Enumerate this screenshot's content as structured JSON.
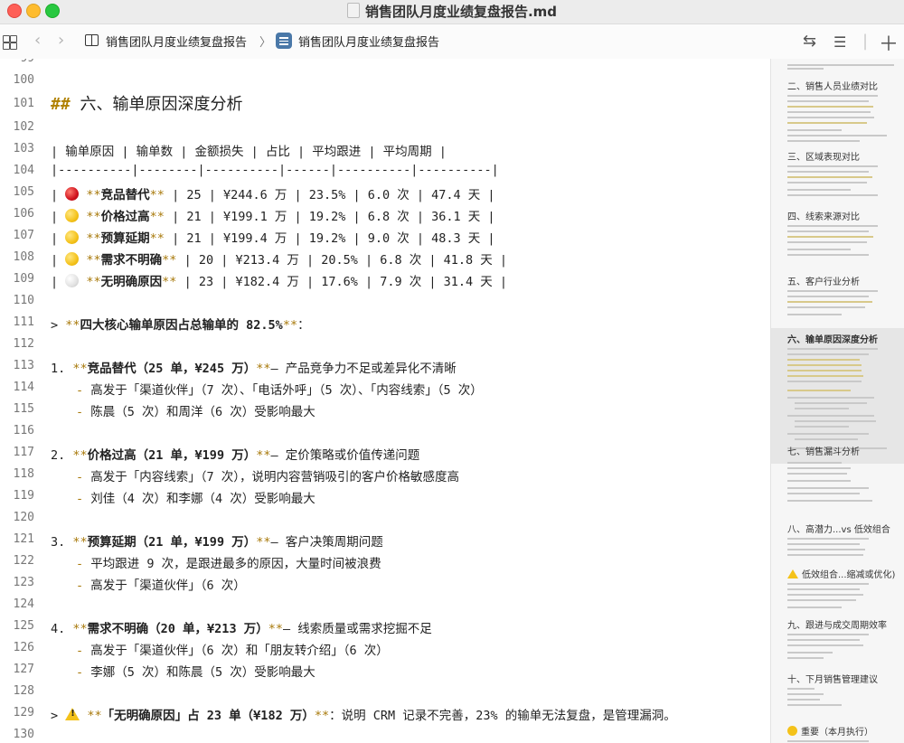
{
  "window": {
    "title": "销售团队月度业绩复盘报告.md"
  },
  "toolbar": {
    "breadcrumb_root": "销售团队月度业绩复盘报告",
    "breadcrumb_current": "销售团队月度业绩复盘报告"
  },
  "editor": {
    "heading": "六、输单原因深度分析",
    "table_header": "| 输单原因 | 输单数 | 金额损失 | 占比 | 平均跟进 | 平均周期 |",
    "table_separator": "|----------|--------|----------|------|----------|----------|",
    "rows": [
      {
        "emoji": "red",
        "name": "竞品替代",
        "rest": " | 25 | ¥244.6 万 | 23.5% | 6.0 次 | 47.4 天 |"
      },
      {
        "emoji": "yellow",
        "name": "价格过高",
        "rest": " | 21 | ¥199.1 万 | 19.2% | 6.8 次 | 36.1 天 |"
      },
      {
        "emoji": "yellow",
        "name": "预算延期",
        "rest": " | 21 | ¥199.4 万 | 19.2% | 9.0 次 | 48.3 天 |"
      },
      {
        "emoji": "yellow",
        "name": "需求不明确",
        "rest": " | 20 | ¥213.4 万 | 20.5% | 6.8 次 | 41.8 天 |"
      },
      {
        "emoji": "white",
        "name": "无明确原因",
        "rest": " | 23 | ¥182.4 万 | 17.6% | 7.9 次 | 31.4 天 |"
      }
    ],
    "quote1": "四大核心输单原因占总输单的 82.5%",
    "items": [
      {
        "num": "1.",
        "title": "竞品替代（25 单，¥245 万）",
        "desc": "— 产品竞争力不足或差异化不清晰",
        "subs": [
          "高发于「渠道伙伴」（7 次）、「电话外呼」（5 次）、「内容线索」（5 次）",
          "陈晨（5 次）和周洋（6 次）受影响最大"
        ]
      },
      {
        "num": "2.",
        "title": "价格过高（21 单，¥199 万）",
        "desc": "— 定价策略或价值传递问题",
        "subs": [
          "高发于「内容线索」（7 次），说明内容营销吸引的客户价格敏感度高",
          "刘佳（4 次）和李娜（4 次）受影响最大"
        ]
      },
      {
        "num": "3.",
        "title": "预算延期（21 单，¥199 万）",
        "desc": "— 客户决策周期问题",
        "subs": [
          "平均跟进 9 次，是跟进最多的原因，大量时间被浪费",
          "高发于「渠道伙伴」（6 次）"
        ]
      },
      {
        "num": "4.",
        "title": "需求不明确（20 单，¥213 万）",
        "desc": "— 线索质量或需求挖掘不足",
        "subs": [
          "高发于「渠道伙伴」（6 次）和「朋友转介绍」（6 次）",
          "李娜（5 次）和陈晨（5 次）受影响最大"
        ]
      }
    ],
    "quote2_bold": "「无明确原因」占 23 单（¥182 万）",
    "quote2_rest": "：说明 CRM 记录不完善，23% 的输单无法复盘，是管理漏洞。"
  },
  "outline": {
    "headings": [
      "二、销售人员业绩对比",
      "三、区域表现对比",
      "四、线索来源对比",
      "五、客户行业分析",
      "六、输单原因深度分析",
      "七、销售漏斗分析",
      "八、高潜力...vs 低效组合",
      "低效组合...缩减或优化)",
      "九、跟进与成交周期效率",
      "十、下月销售管理建议",
      "重要（本月执行）"
    ]
  }
}
